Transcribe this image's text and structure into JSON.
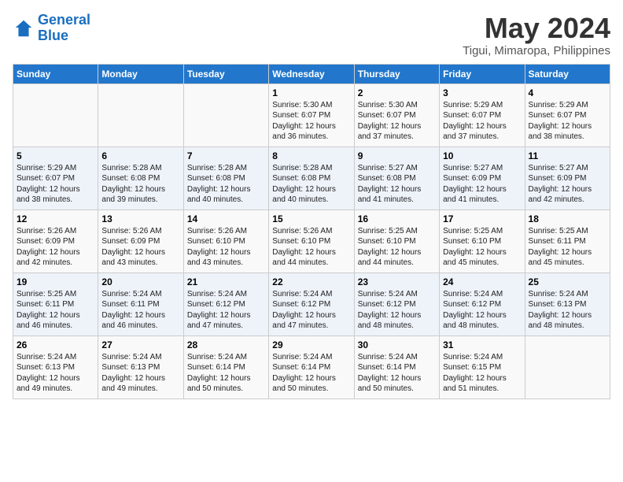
{
  "header": {
    "logo_line1": "General",
    "logo_line2": "Blue",
    "main_title": "May 2024",
    "subtitle": "Tigui, Mimaropa, Philippines"
  },
  "days_of_week": [
    "Sunday",
    "Monday",
    "Tuesday",
    "Wednesday",
    "Thursday",
    "Friday",
    "Saturday"
  ],
  "weeks": [
    [
      {
        "day": "",
        "info": ""
      },
      {
        "day": "",
        "info": ""
      },
      {
        "day": "",
        "info": ""
      },
      {
        "day": "1",
        "info": "Sunrise: 5:30 AM\nSunset: 6:07 PM\nDaylight: 12 hours\nand 36 minutes."
      },
      {
        "day": "2",
        "info": "Sunrise: 5:30 AM\nSunset: 6:07 PM\nDaylight: 12 hours\nand 37 minutes."
      },
      {
        "day": "3",
        "info": "Sunrise: 5:29 AM\nSunset: 6:07 PM\nDaylight: 12 hours\nand 37 minutes."
      },
      {
        "day": "4",
        "info": "Sunrise: 5:29 AM\nSunset: 6:07 PM\nDaylight: 12 hours\nand 38 minutes."
      }
    ],
    [
      {
        "day": "5",
        "info": "Sunrise: 5:29 AM\nSunset: 6:07 PM\nDaylight: 12 hours\nand 38 minutes."
      },
      {
        "day": "6",
        "info": "Sunrise: 5:28 AM\nSunset: 6:08 PM\nDaylight: 12 hours\nand 39 minutes."
      },
      {
        "day": "7",
        "info": "Sunrise: 5:28 AM\nSunset: 6:08 PM\nDaylight: 12 hours\nand 40 minutes."
      },
      {
        "day": "8",
        "info": "Sunrise: 5:28 AM\nSunset: 6:08 PM\nDaylight: 12 hours\nand 40 minutes."
      },
      {
        "day": "9",
        "info": "Sunrise: 5:27 AM\nSunset: 6:08 PM\nDaylight: 12 hours\nand 41 minutes."
      },
      {
        "day": "10",
        "info": "Sunrise: 5:27 AM\nSunset: 6:09 PM\nDaylight: 12 hours\nand 41 minutes."
      },
      {
        "day": "11",
        "info": "Sunrise: 5:27 AM\nSunset: 6:09 PM\nDaylight: 12 hours\nand 42 minutes."
      }
    ],
    [
      {
        "day": "12",
        "info": "Sunrise: 5:26 AM\nSunset: 6:09 PM\nDaylight: 12 hours\nand 42 minutes."
      },
      {
        "day": "13",
        "info": "Sunrise: 5:26 AM\nSunset: 6:09 PM\nDaylight: 12 hours\nand 43 minutes."
      },
      {
        "day": "14",
        "info": "Sunrise: 5:26 AM\nSunset: 6:10 PM\nDaylight: 12 hours\nand 43 minutes."
      },
      {
        "day": "15",
        "info": "Sunrise: 5:26 AM\nSunset: 6:10 PM\nDaylight: 12 hours\nand 44 minutes."
      },
      {
        "day": "16",
        "info": "Sunrise: 5:25 AM\nSunset: 6:10 PM\nDaylight: 12 hours\nand 44 minutes."
      },
      {
        "day": "17",
        "info": "Sunrise: 5:25 AM\nSunset: 6:10 PM\nDaylight: 12 hours\nand 45 minutes."
      },
      {
        "day": "18",
        "info": "Sunrise: 5:25 AM\nSunset: 6:11 PM\nDaylight: 12 hours\nand 45 minutes."
      }
    ],
    [
      {
        "day": "19",
        "info": "Sunrise: 5:25 AM\nSunset: 6:11 PM\nDaylight: 12 hours\nand 46 minutes."
      },
      {
        "day": "20",
        "info": "Sunrise: 5:24 AM\nSunset: 6:11 PM\nDaylight: 12 hours\nand 46 minutes."
      },
      {
        "day": "21",
        "info": "Sunrise: 5:24 AM\nSunset: 6:12 PM\nDaylight: 12 hours\nand 47 minutes."
      },
      {
        "day": "22",
        "info": "Sunrise: 5:24 AM\nSunset: 6:12 PM\nDaylight: 12 hours\nand 47 minutes."
      },
      {
        "day": "23",
        "info": "Sunrise: 5:24 AM\nSunset: 6:12 PM\nDaylight: 12 hours\nand 48 minutes."
      },
      {
        "day": "24",
        "info": "Sunrise: 5:24 AM\nSunset: 6:12 PM\nDaylight: 12 hours\nand 48 minutes."
      },
      {
        "day": "25",
        "info": "Sunrise: 5:24 AM\nSunset: 6:13 PM\nDaylight: 12 hours\nand 48 minutes."
      }
    ],
    [
      {
        "day": "26",
        "info": "Sunrise: 5:24 AM\nSunset: 6:13 PM\nDaylight: 12 hours\nand 49 minutes."
      },
      {
        "day": "27",
        "info": "Sunrise: 5:24 AM\nSunset: 6:13 PM\nDaylight: 12 hours\nand 49 minutes."
      },
      {
        "day": "28",
        "info": "Sunrise: 5:24 AM\nSunset: 6:14 PM\nDaylight: 12 hours\nand 50 minutes."
      },
      {
        "day": "29",
        "info": "Sunrise: 5:24 AM\nSunset: 6:14 PM\nDaylight: 12 hours\nand 50 minutes."
      },
      {
        "day": "30",
        "info": "Sunrise: 5:24 AM\nSunset: 6:14 PM\nDaylight: 12 hours\nand 50 minutes."
      },
      {
        "day": "31",
        "info": "Sunrise: 5:24 AM\nSunset: 6:15 PM\nDaylight: 12 hours\nand 51 minutes."
      },
      {
        "day": "",
        "info": ""
      }
    ]
  ]
}
